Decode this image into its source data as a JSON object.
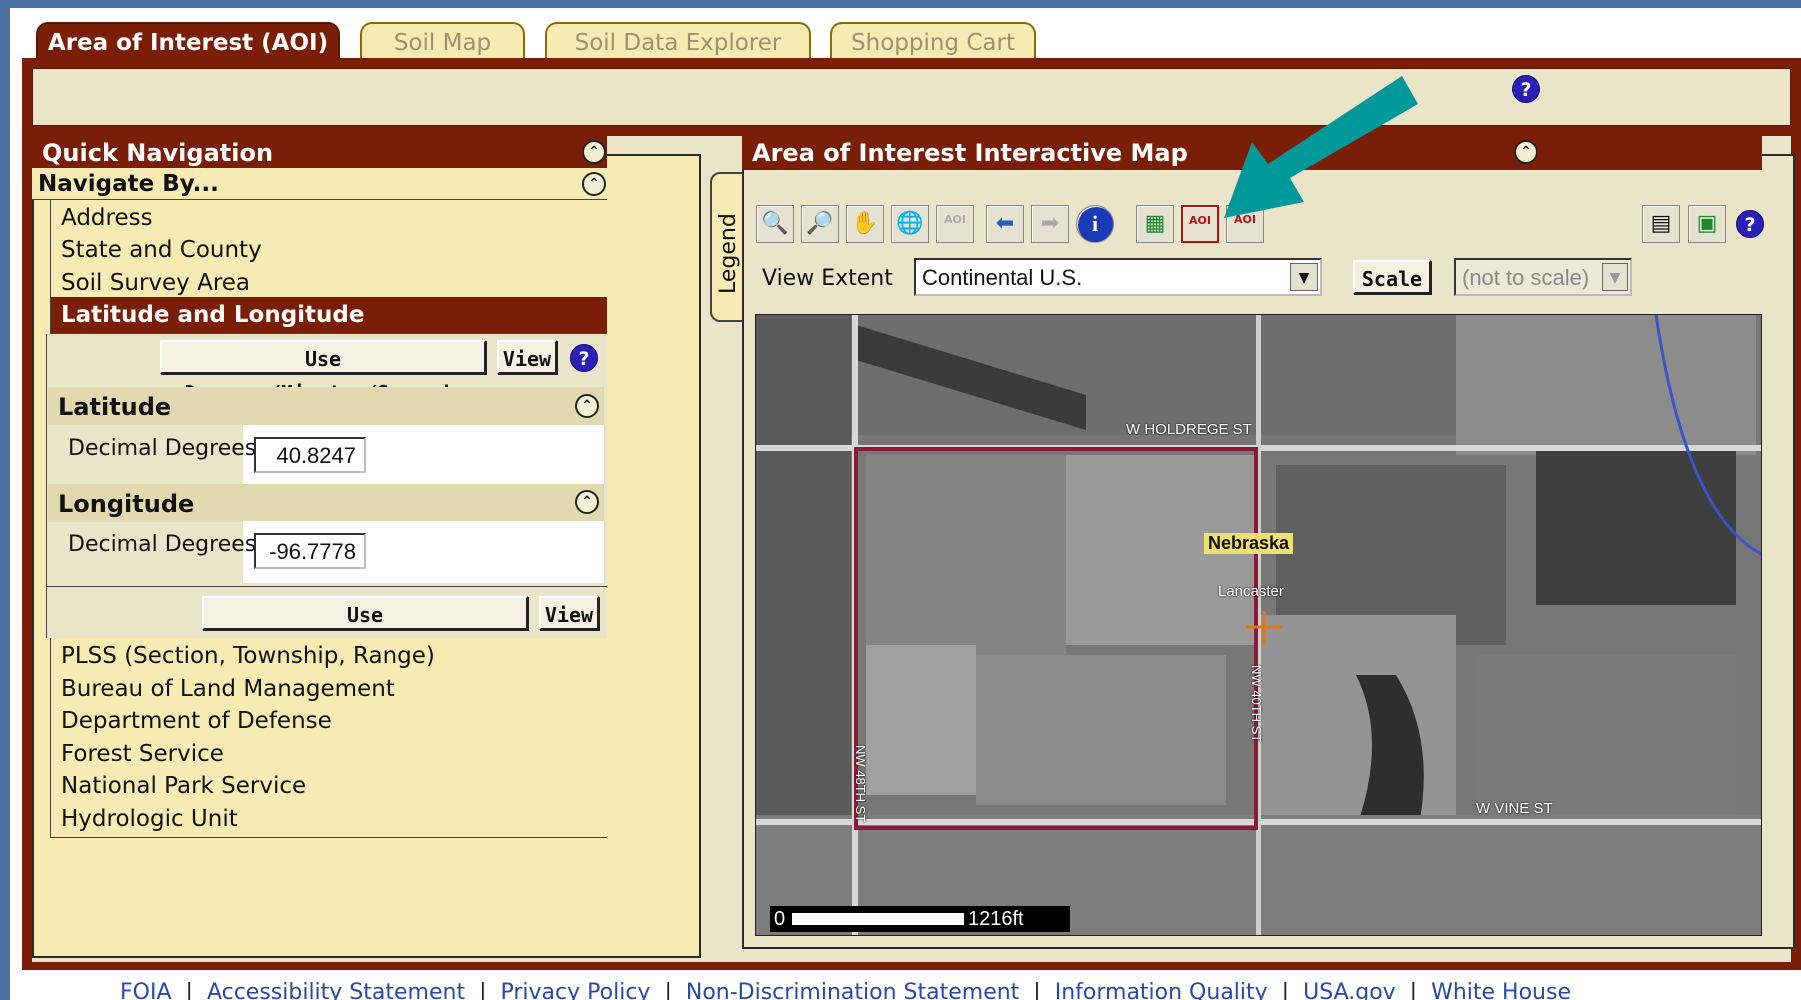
{
  "tabs": [
    {
      "label": "Area of Interest (AOI)",
      "active": true
    },
    {
      "label": "Soil Map",
      "active": false
    },
    {
      "label": "Soil Data Explorer",
      "active": false
    },
    {
      "label": "Shopping Cart",
      "active": false
    }
  ],
  "help_glyph": "?",
  "collapse_glyph": "⌃",
  "quick_nav": {
    "title": "Quick Navigation",
    "navigate_by": "Navigate By...",
    "items_top": [
      "Address",
      "State and County",
      "Soil Survey Area"
    ],
    "selected_item": "Latitude and Longitude",
    "dms_button": "Use Degrees/Minutes/Seconds",
    "view_button": "View",
    "latitude": {
      "title": "Latitude",
      "label": "Decimal Degrees",
      "value": "40.8247"
    },
    "longitude": {
      "title": "Longitude",
      "label": "Decimal Degrees",
      "value": "-96.7778"
    },
    "items_bottom": [
      "PLSS (Section, Township, Range)",
      "Bureau of Land Management",
      "Department of Defense",
      "Forest Service",
      "National Park Service",
      "Hydrologic Unit"
    ]
  },
  "legend_tab": "Legend",
  "map_panel": {
    "title": "Area of Interest Interactive Map",
    "tools": [
      {
        "icon": "zoom-in-icon",
        "glyph": "🔍"
      },
      {
        "icon": "zoom-out-icon",
        "glyph": "🔎"
      },
      {
        "icon": "pan-hand-icon",
        "glyph": "✋"
      },
      {
        "icon": "full-extent-globe-icon",
        "glyph": "🌐"
      },
      {
        "icon": "aoi-disabled-icon",
        "glyph": "AOI"
      },
      {
        "icon": "back-arrow-icon",
        "glyph": "⬅"
      },
      {
        "icon": "forward-arrow-icon",
        "glyph": "➡"
      },
      {
        "icon": "info-icon",
        "glyph": "i"
      },
      {
        "icon": "layers-icon",
        "glyph": "▦"
      },
      {
        "icon": "aoi-rectangle-icon",
        "glyph": "AOI"
      },
      {
        "icon": "aoi-polygon-icon",
        "glyph": "AOI"
      }
    ],
    "view_extent_label": "View Extent",
    "view_extent_value": "Continental U.S.",
    "scale_button": "Scale",
    "scale_value": "(not to scale)",
    "map_labels": {
      "holdrege": "W HOLDREGE ST",
      "state": "Nebraska",
      "county": "Lancaster",
      "nw40": "NW 40TH ST",
      "nw48": "NW 48TH ST",
      "vine": "W VINE ST"
    },
    "scale_zero": "0",
    "scale_distance": "1216ft"
  },
  "footer_links": [
    "FOIA",
    "Accessibility Statement",
    "Privacy Policy",
    "Non-Discrimination Statement",
    "Information Quality",
    "USA.gov",
    "White House"
  ],
  "colors": {
    "brand": "#7b1e08",
    "panel": "#f6ecb3",
    "aoi_box": "#8b1a3a",
    "arrow": "#00999a"
  }
}
